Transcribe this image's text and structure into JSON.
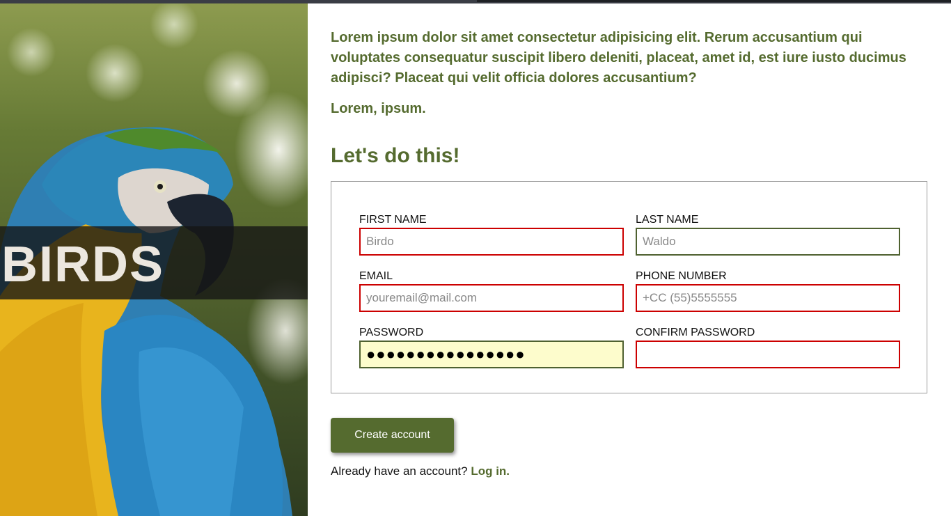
{
  "hero": {
    "title": "BIRDS",
    "image": "macaw parrot photo"
  },
  "intro": {
    "paragraph": "Lorem ipsum dolor sit amet consectetur adipisicing elit. Rerum accusantium qui voluptates consequatur suscipit libero deleniti, placeat, amet id, est iure iusto ducimus adipisci? Placeat qui velit officia dolores accusantium?",
    "short": "Lorem, ipsum."
  },
  "form": {
    "heading": "Let's do this!",
    "fields": {
      "first_name": {
        "label": "FIRST NAME",
        "placeholder": "Birdo",
        "value": ""
      },
      "last_name": {
        "label": "LAST NAME",
        "placeholder": "Waldo",
        "value": ""
      },
      "email": {
        "label": "EMAIL",
        "placeholder": "youremail@mail.com",
        "value": ""
      },
      "phone": {
        "label": "PHONE NUMBER",
        "placeholder": "+CC (55)5555555",
        "value": ""
      },
      "password": {
        "label": "PASSWORD",
        "value": "●●●●●●●●●●●●●●●●"
      },
      "confirm_password": {
        "label": "CONFIRM PASSWORD",
        "value": ""
      }
    },
    "submit_label": "Create account",
    "login_prompt": "Already have an account?",
    "login_link": "Log in."
  },
  "colors": {
    "accent": "#556b2f",
    "invalid_border": "#cc0000",
    "valid_border": "#4f6130",
    "autofill_bg": "#fdfccc"
  }
}
